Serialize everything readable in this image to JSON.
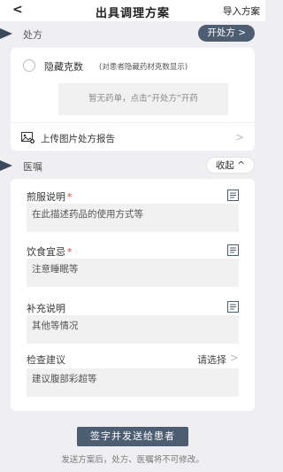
{
  "nav": {
    "back": "<",
    "title": "出具调理方案",
    "import_label": "导入方案"
  },
  "prescription": {
    "section_label": "处方",
    "open_button": "开处方 >",
    "hide_dose_label": "隐藏克数",
    "hide_dose_hint": "(对患者隐藏药材克数显示)",
    "empty_text": "暂无药单，点击“开处方”开药",
    "upload_label": "上传图片处方报告"
  },
  "advice": {
    "section_label": "医嘱",
    "collapse_button": "收起 ^",
    "decoction": {
      "label": "煎服说明",
      "placeholder": "在此描述药品的使用方式等"
    },
    "diet": {
      "label": "饮食宜忌",
      "placeholder": "注意睡眠等"
    },
    "supplement": {
      "label": "补充说明",
      "placeholder": "其他等情况"
    },
    "exam": {
      "label": "检查建议",
      "select_label": "请选择",
      "placeholder": "建议腹部彩超等"
    },
    "required_mark": "*"
  },
  "footer": {
    "submit_button": "签字并发送给患者",
    "notice": "发送方案后，处方、医嘱将不可修改。"
  },
  "colors": {
    "primary": "#4d5d72",
    "required": "#cc4444",
    "background": "#efeff2"
  }
}
